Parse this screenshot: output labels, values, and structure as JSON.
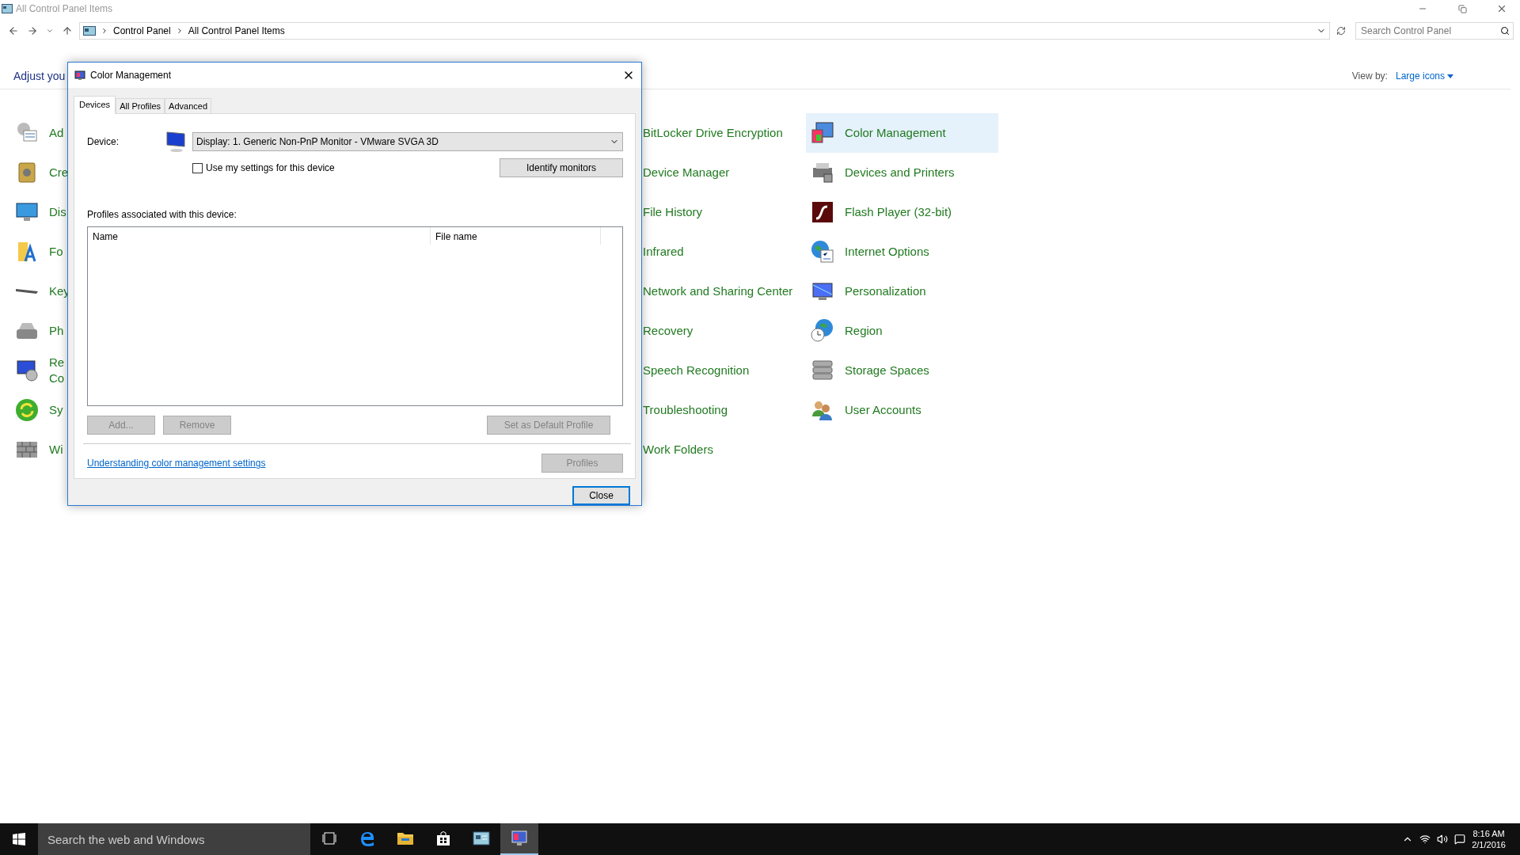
{
  "window": {
    "title": "All Control Panel Items"
  },
  "address_bar": {
    "breadcrumbs": [
      "Control Panel",
      "All Control Panel Items"
    ]
  },
  "search": {
    "placeholder": "Search Control Panel"
  },
  "heading": "Adjust you",
  "view_by": {
    "label": "View by:",
    "value": "Large icons"
  },
  "columns": [
    {
      "items": [
        {
          "label": "Ad",
          "selected": false
        },
        {
          "label": "Cre",
          "selected": false
        },
        {
          "label": "Dis",
          "selected": false
        },
        {
          "label": "Fo",
          "selected": false
        },
        {
          "label": "Key",
          "selected": false
        },
        {
          "label": "Ph",
          "selected": false
        },
        {
          "label": "Re\nCo",
          "selected": false
        },
        {
          "label": "Sy",
          "selected": false
        },
        {
          "label": "Wi",
          "selected": false
        }
      ]
    },
    {
      "items": [
        {
          "label": "BitLocker Drive Encryption",
          "selected": false
        },
        {
          "label": "Device Manager",
          "selected": false
        },
        {
          "label": "File History",
          "selected": false
        },
        {
          "label": "Infrared",
          "selected": false
        },
        {
          "label": "Network and Sharing Center",
          "selected": false
        },
        {
          "label": "Recovery",
          "selected": false
        },
        {
          "label": "Speech Recognition",
          "selected": false
        },
        {
          "label": "Troubleshooting",
          "selected": false
        },
        {
          "label": "Work Folders",
          "selected": false
        }
      ]
    },
    {
      "items": [
        {
          "label": "Color Management",
          "selected": true
        },
        {
          "label": "Devices and Printers",
          "selected": false
        },
        {
          "label": "Flash Player (32-bit)",
          "selected": false
        },
        {
          "label": "Internet Options",
          "selected": false
        },
        {
          "label": "Personalization",
          "selected": false
        },
        {
          "label": "Region",
          "selected": false
        },
        {
          "label": "Storage Spaces",
          "selected": false
        },
        {
          "label": "User Accounts",
          "selected": false
        }
      ]
    }
  ],
  "dialog": {
    "title": "Color Management",
    "tabs": [
      {
        "label": "Devices",
        "selected": true
      },
      {
        "label": "All Profiles",
        "selected": false
      },
      {
        "label": "Advanced",
        "selected": false
      }
    ],
    "device_label": "Device:",
    "device_value": "Display: 1. Generic Non-PnP Monitor - VMware SVGA 3D",
    "use_settings": {
      "label": "Use my settings for this device",
      "checked": false
    },
    "identify_button": {
      "label": "Identify monitors",
      "disabled": false
    },
    "profiles_label": "Profiles associated with this device:",
    "table_columns": [
      "Name",
      "File name"
    ],
    "profile_buttons": [
      {
        "label": "Add...",
        "disabled": true
      },
      {
        "label": "Remove",
        "disabled": true
      },
      {
        "label": "Set as Default Profile",
        "disabled": true
      }
    ],
    "link": "Understanding color management settings",
    "profiles_button": {
      "label": "Profiles",
      "disabled": true
    },
    "close_button": {
      "label": "Close",
      "disabled": false
    }
  },
  "taskbar": {
    "search_placeholder": "Search the web and Windows",
    "apps": [
      {
        "selected": false
      },
      {
        "selected": false
      },
      {
        "selected": false
      },
      {
        "selected": false
      },
      {
        "selected": false
      },
      {
        "selected": true
      }
    ],
    "time": "8:16 AM",
    "date": "2/1/2016"
  }
}
